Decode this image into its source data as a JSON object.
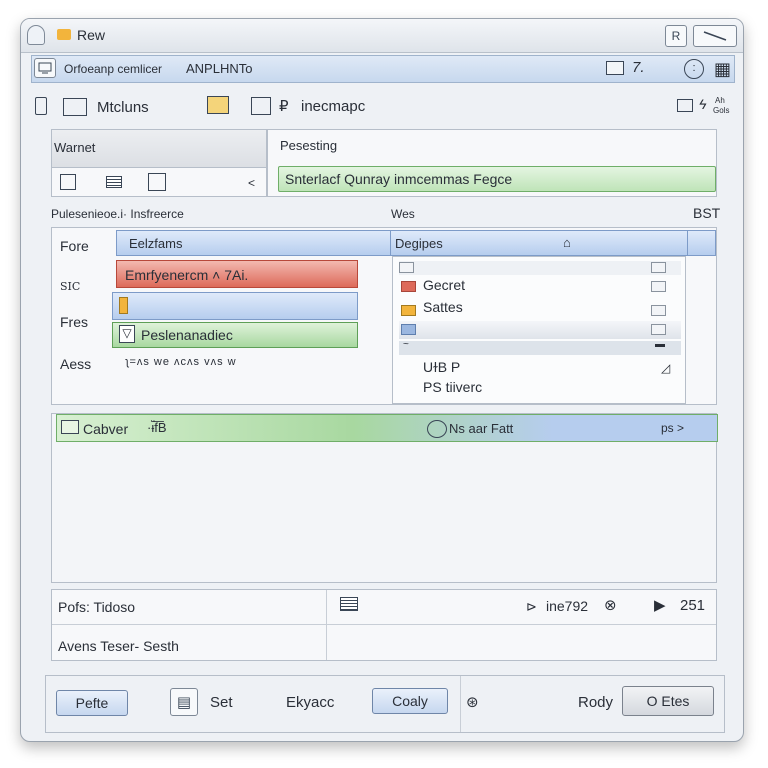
{
  "window": {
    "title": "Rew"
  },
  "titlebar": {
    "icon_btn_label": "R"
  },
  "toolbar": {
    "path_text": "Orfoeanp cemlicer",
    "app_name": "ANPLHNTo",
    "right_text": "7."
  },
  "row2": {
    "item1_label": "Mtcluns",
    "item2_label": "inecmapc",
    "right_badge_top": "Ah",
    "right_badge_bottom": "Gols"
  },
  "left_top": {
    "header": "Warnet",
    "chevron": "<"
  },
  "right_top": {
    "header": "Pesesting",
    "search_value": "Snterlacf Qunray inmcemmas Fegce"
  },
  "section_labels": {
    "left": "Pulesenieoe.i· Insfreerce",
    "mid": "Wes",
    "right": "BST"
  },
  "form": {
    "rows": [
      "Fore",
      "SIC",
      "Fres",
      "Aess"
    ],
    "field1": "Eelzfams",
    "field2": "Emrfyenercm ˄ 7Ai.",
    "field4": "Peslenanadiec",
    "waveform": "ʅ=ᴧs we ᴧcᴧs vᴧs w"
  },
  "list": {
    "header": "Degipes",
    "items": [
      "Gecret",
      "Sattes"
    ],
    "foot1": "UɫB P",
    "foot2": "PS tiiverc"
  },
  "green_bar": {
    "left_label": "Cabver",
    "glyph": "·ᵼ̈f͞B",
    "center_label": "Ns aar Fatt",
    "right_label": "ps >"
  },
  "status": {
    "left_top": "Pofs: Tidoso",
    "left_bottom": "Avens Teser- Sesth",
    "right_label": "ine792",
    "count": "251"
  },
  "footer": {
    "btn1": "Pefte",
    "set_label": "Set",
    "mid_label": "Ekyacc",
    "btn2": "Coaly",
    "rody_label": "Rody",
    "btn3": "O Etes"
  },
  "colors": {
    "accent_blue": "#b6cdee",
    "accent_green": "#a8d8a0",
    "accent_red": "#dd6a5a"
  }
}
